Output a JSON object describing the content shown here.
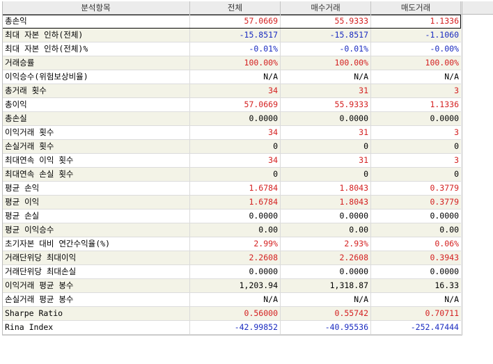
{
  "columns": [
    "분석항목",
    "전체",
    "매수거래",
    "매도거래"
  ],
  "rows": [
    {
      "label": "총손익",
      "values": [
        "57.0669",
        "55.9333",
        "1.1336"
      ],
      "colors": [
        "red",
        "red",
        "red"
      ]
    },
    {
      "label": "최대 자본 인하(전체)",
      "values": [
        "-15.8517",
        "-15.8517",
        "-1.1060"
      ],
      "colors": [
        "blue",
        "blue",
        "blue"
      ]
    },
    {
      "label": "최대 자본 인하(전체)%",
      "values": [
        "-0.01%",
        "-0.01%",
        "-0.00%"
      ],
      "colors": [
        "blue",
        "blue",
        "blue"
      ]
    },
    {
      "label": "거래승률",
      "values": [
        "100.00%",
        "100.00%",
        "100.00%"
      ],
      "colors": [
        "red",
        "red",
        "red"
      ]
    },
    {
      "label": "이익승수(위험보상비율)",
      "values": [
        "N/A",
        "N/A",
        "N/A"
      ],
      "colors": [
        "black",
        "black",
        "black"
      ]
    },
    {
      "label": "총거래 횟수",
      "values": [
        "34",
        "31",
        "3"
      ],
      "colors": [
        "red",
        "red",
        "red"
      ]
    },
    {
      "label": "총이익",
      "values": [
        "57.0669",
        "55.9333",
        "1.1336"
      ],
      "colors": [
        "red",
        "red",
        "red"
      ]
    },
    {
      "label": "총손실",
      "values": [
        "0.0000",
        "0.0000",
        "0.0000"
      ],
      "colors": [
        "black",
        "black",
        "black"
      ]
    },
    {
      "label": "이익거래 횟수",
      "values": [
        "34",
        "31",
        "3"
      ],
      "colors": [
        "red",
        "red",
        "red"
      ]
    },
    {
      "label": "손실거래 횟수",
      "values": [
        "0",
        "0",
        "0"
      ],
      "colors": [
        "black",
        "black",
        "black"
      ]
    },
    {
      "label": "최대연속 이익 횟수",
      "values": [
        "34",
        "31",
        "3"
      ],
      "colors": [
        "red",
        "red",
        "red"
      ]
    },
    {
      "label": "최대연속 손실 횟수",
      "values": [
        "0",
        "0",
        "0"
      ],
      "colors": [
        "black",
        "black",
        "black"
      ]
    },
    {
      "label": "평균 손익",
      "values": [
        "1.6784",
        "1.8043",
        "0.3779"
      ],
      "colors": [
        "red",
        "red",
        "red"
      ]
    },
    {
      "label": "평균 이익",
      "values": [
        "1.6784",
        "1.8043",
        "0.3779"
      ],
      "colors": [
        "red",
        "red",
        "red"
      ]
    },
    {
      "label": "평균 손실",
      "values": [
        "0.0000",
        "0.0000",
        "0.0000"
      ],
      "colors": [
        "black",
        "black",
        "black"
      ]
    },
    {
      "label": "평균 이익승수",
      "values": [
        "0.00",
        "0.00",
        "0.00"
      ],
      "colors": [
        "black",
        "black",
        "black"
      ]
    },
    {
      "label": "초기자본 대비 연간수익율(%)",
      "values": [
        "2.99%",
        "2.93%",
        "0.06%"
      ],
      "colors": [
        "red",
        "red",
        "red"
      ]
    },
    {
      "label": "거래단위당 최대이익",
      "values": [
        "2.2608",
        "2.2608",
        "0.3943"
      ],
      "colors": [
        "red",
        "red",
        "red"
      ]
    },
    {
      "label": "거래단위당 최대손실",
      "values": [
        "0.0000",
        "0.0000",
        "0.0000"
      ],
      "colors": [
        "black",
        "black",
        "black"
      ]
    },
    {
      "label": "이익거래 평균 봉수",
      "values": [
        "1,203.94",
        "1,318.87",
        "16.33"
      ],
      "colors": [
        "black",
        "black",
        "black"
      ]
    },
    {
      "label": "손실거래 평균 봉수",
      "values": [
        "N/A",
        "N/A",
        "N/A"
      ],
      "colors": [
        "black",
        "black",
        "black"
      ]
    },
    {
      "label": "Sharpe Ratio",
      "values": [
        "0.56000",
        "0.55742",
        "0.70711"
      ],
      "colors": [
        "red",
        "red",
        "red"
      ]
    },
    {
      "label": "Rina Index",
      "values": [
        "-42.99852",
        "-40.95536",
        "-252.47444"
      ],
      "colors": [
        "blue",
        "blue",
        "blue"
      ]
    }
  ],
  "selected_row": 0,
  "colors": {
    "red": "#d42020",
    "blue": "#1a2bc0",
    "alt_row_bg": "#f3f3e7",
    "header_bg": "#ececec"
  }
}
